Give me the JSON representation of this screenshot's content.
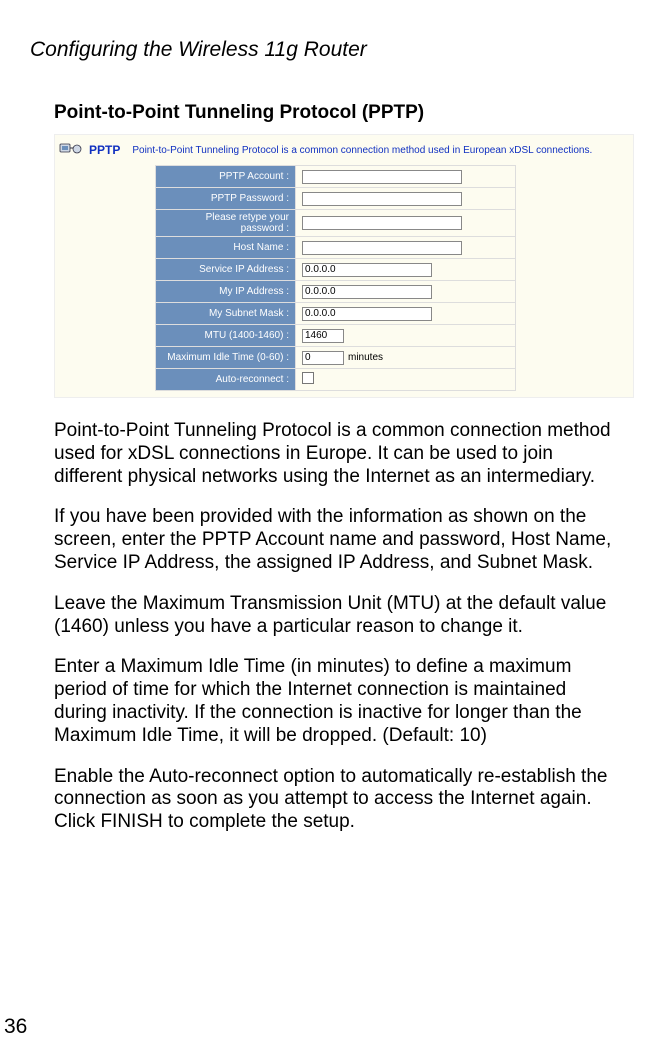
{
  "header": "Configuring the Wireless 11g Router",
  "sectionTitle": "Point-to-Point Tunneling Protocol (PPTP)",
  "screenshot": {
    "pptpLabel": "PPTP",
    "pptpDesc": "Point-to-Point Tunneling Protocol is a common connection method used in European xDSL connections.",
    "rows": [
      {
        "label": "PPTP Account :",
        "value": "",
        "cls": "w-long"
      },
      {
        "label": "PPTP Password :",
        "value": "",
        "cls": "w-long"
      },
      {
        "label": "Please retype your\npassword :",
        "value": "",
        "cls": "w-long"
      },
      {
        "label": "Host Name :",
        "value": "",
        "cls": "w-long"
      },
      {
        "label": "Service IP Address :",
        "value": "0.0.0.0",
        "cls": "w-mid"
      },
      {
        "label": "My IP Address :",
        "value": "0.0.0.0",
        "cls": "w-mid"
      },
      {
        "label": "My Subnet Mask :",
        "value": "0.0.0.0",
        "cls": "w-mid"
      },
      {
        "label": "MTU (1400-1460) :",
        "value": "1460",
        "cls": "w-short"
      },
      {
        "label": "Maximum Idle Time (0-60) :",
        "value": "0",
        "cls": "w-short",
        "suffix": "minutes"
      },
      {
        "label": "Auto-reconnect :",
        "checkbox": true
      }
    ]
  },
  "paragraphs": [
    "Point-to-Point Tunneling Protocol is a common connection method used for xDSL connections in Europe. It can be used to join different physical networks using the Internet as an intermediary.",
    "If you have been provided with the information as shown on the screen, enter the PPTP Account name and password, Host Name, Service IP Address, the assigned IP Address, and Subnet Mask.",
    "Leave the Maximum Transmission Unit (MTU) at the default value (1460) unless you have a particular reason to change it.",
    "Enter a Maximum Idle Time (in minutes) to define a maximum period of time for which the Internet connection is maintained during inactivity. If the connection is inactive for longer than the Maximum Idle Time, it will be dropped. (Default: 10)",
    "Enable the Auto-reconnect option to automatically re-establish the connection as soon as you attempt to access the Internet again. Click FINISH to complete the setup."
  ],
  "pageNumber": "36"
}
